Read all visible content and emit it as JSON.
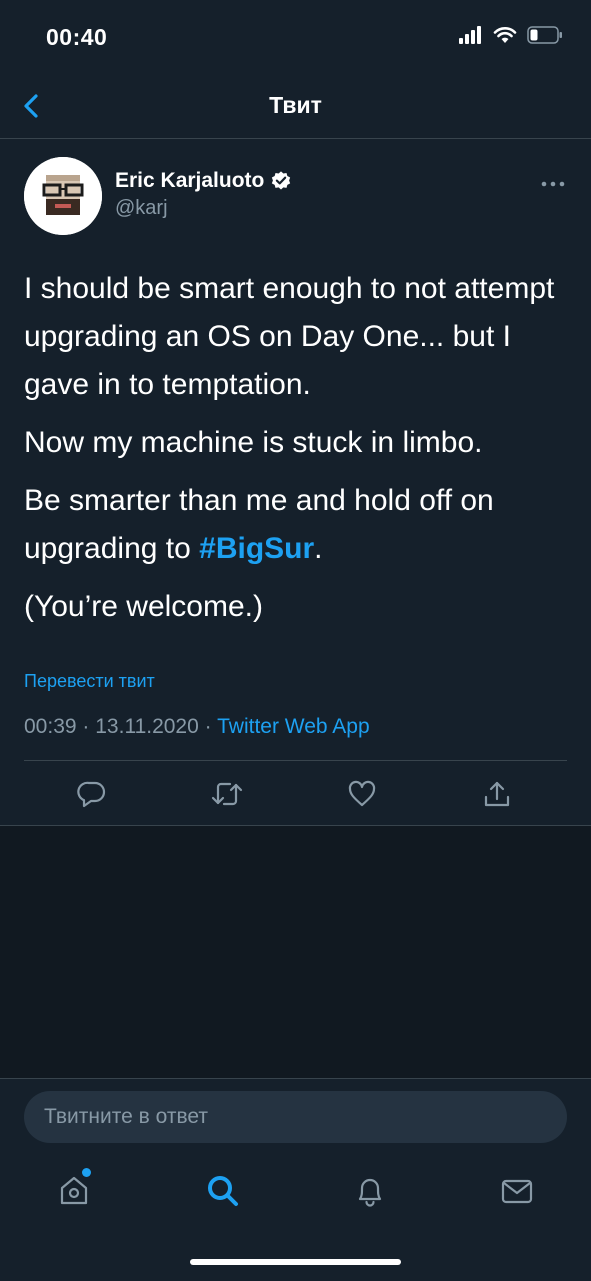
{
  "status_bar": {
    "time": "00:40"
  },
  "nav": {
    "title": "Твит"
  },
  "tweet": {
    "author_name": "Eric Karjaluoto",
    "handle": "@karj",
    "paragraphs": {
      "p1": "I should be smart enough to not attempt upgrading an OS on Day One... but I gave in to temptation.",
      "p2": "Now my machine is stuck in limbo.",
      "p3_before": "Be smarter than me and hold off on upgrading to ",
      "p3_hashtag": "#BigSur",
      "p3_after": ".",
      "p4": "(You’re welcome.)"
    },
    "translate_label": "Перевести твит",
    "time": "00:39",
    "date": "13.11.2020",
    "separator": "·",
    "source_app": "Twitter Web App"
  },
  "reply": {
    "placeholder": "Твитните в ответ"
  },
  "icons": {
    "back": "chevron-left-icon",
    "verified": "verified-badge-icon",
    "more": "more-horizontal-icon",
    "reply": "comment-icon",
    "retweet": "retweet-icon",
    "like": "heart-icon",
    "share": "share-icon",
    "home": "home-icon",
    "search": "search-icon",
    "notifications": "bell-icon",
    "messages": "mail-icon"
  },
  "colors": {
    "background": "#15202b",
    "accent": "#1da1f2",
    "secondary_text": "#8899a6",
    "border": "#38444d"
  }
}
